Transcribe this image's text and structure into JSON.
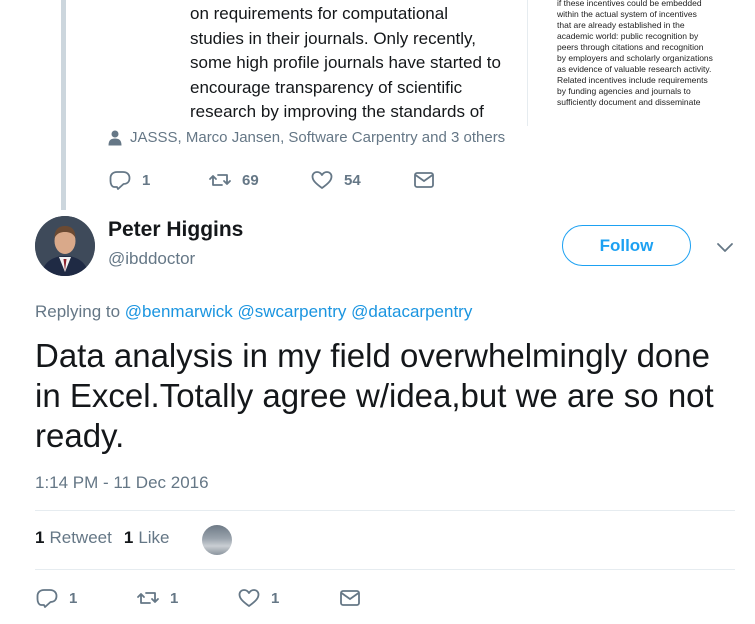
{
  "quoted_tweet": {
    "text_lines": [
      "on requirements for computational",
      "studies in their journals. Only recently,",
      "some high profile journals have started to",
      "encourage transparency of scientific",
      "research by improving the standards of"
    ],
    "image_text_lines": [
      "if these incentives could be embedded",
      "within the actual system of incentives",
      "that are already established in the",
      "academic world: public recognition by",
      "peers through citations and recognition",
      "by employers and scholarly organizations",
      "as evidence of valuable research activity.",
      "Related incentives include requirements",
      "by funding agencies and journals to",
      "sufficiently document and disseminate"
    ],
    "tagged_people": "JASSS, Marco Jansen, Software Carpentry and 3 others",
    "actions": {
      "replies": "1",
      "retweets": "69",
      "likes": "54"
    }
  },
  "tweet": {
    "display_name": "Peter Higgins",
    "handle": "@ibddoctor",
    "follow_label": "Follow",
    "replying_prefix": "Replying to",
    "replying_to": [
      "@benmarwick",
      "@swcarpentry",
      "@datacarpentry"
    ],
    "text": "Data analysis in my field overwhelmingly done in Excel.Totally agree w/idea,but we are so not ready.",
    "timestamp": "1:14 PM - 11 Dec 2016",
    "retweet_count": "1",
    "retweet_label": "Retweet",
    "like_count": "1",
    "like_label": "Like",
    "actions": {
      "replies": "1",
      "retweets": "1",
      "likes": "1"
    }
  },
  "colors": {
    "accent": "#1da1f2",
    "link": "#1b95e0",
    "muted": "#657786",
    "text": "#14171a"
  },
  "icons": [
    "person-icon",
    "reply-icon",
    "retweet-icon",
    "like-icon",
    "message-icon",
    "chevron-down-icon"
  ]
}
